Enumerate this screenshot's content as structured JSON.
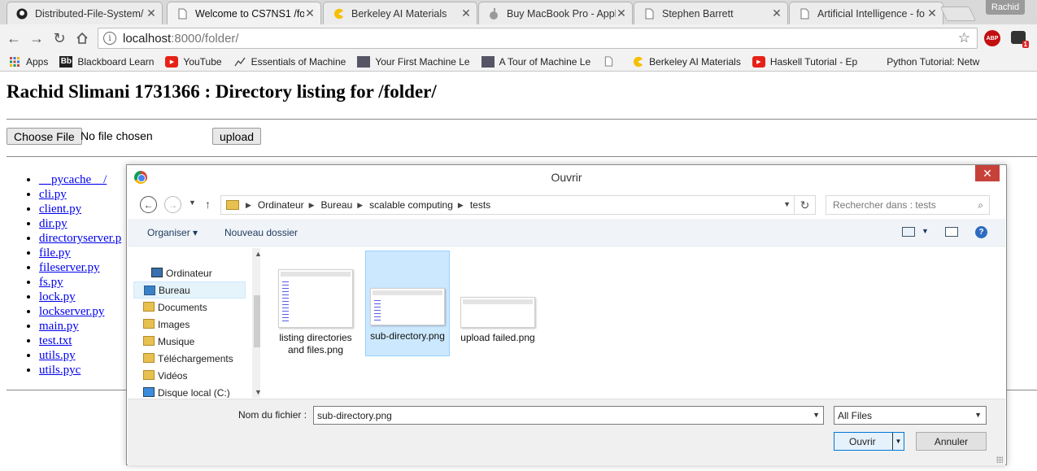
{
  "tabs": [
    {
      "title": "Distributed-File-System/",
      "icon": "github-icon"
    },
    {
      "title": "Welcome to CS7NS1 /fol",
      "icon": "page-icon",
      "active": true
    },
    {
      "title": "Berkeley AI Materials",
      "icon": "pacman-icon"
    },
    {
      "title": "Buy MacBook Pro - Appl",
      "icon": "apple-icon"
    },
    {
      "title": "Stephen Barrett",
      "icon": "page-icon"
    },
    {
      "title": "Artificial Intelligence - fo",
      "icon": "page-icon"
    }
  ],
  "profile_name": "Rachid",
  "address": {
    "host": "localhost",
    "rest": ":8000/folder/"
  },
  "extensions": {
    "abp_label": "ABP",
    "badge_count": "1"
  },
  "bookmarks": [
    {
      "label": "Apps",
      "icon": "apps-grid-icon"
    },
    {
      "label": "Blackboard Learn",
      "icon": "blackboard-icon"
    },
    {
      "label": "YouTube",
      "icon": "youtube-icon"
    },
    {
      "label": "Essentials of Machine",
      "icon": "chart-icon"
    },
    {
      "label": "Your First Machine Le",
      "icon": "person-icon"
    },
    {
      "label": "A Tour of Machine Le",
      "icon": "person-icon"
    },
    {
      "label": "",
      "icon": "page-icon"
    },
    {
      "label": "Berkeley AI Materials",
      "icon": "pacman-icon"
    },
    {
      "label": "Haskell Tutorial - Ep",
      "icon": "youtube-icon"
    },
    {
      "label": "Python Tutorial: Netw",
      "icon": "blank-icon"
    }
  ],
  "page": {
    "heading": "Rachid Slimani 1731366 : Directory listing for /folder/",
    "choose_file_label": "Choose File",
    "no_file_text": "No file chosen",
    "upload_label": "upload",
    "files": [
      "__pycache__/",
      "cli.py",
      "client.py",
      "dir.py",
      "directoryserver.p",
      "file.py",
      "fileserver.py",
      "fs.py",
      "lock.py",
      "lockserver.py",
      "main.py",
      "test.txt",
      "utils.py",
      "utils.pyc"
    ]
  },
  "dialog": {
    "title": "Ouvrir",
    "breadcrumb": [
      "Ordinateur",
      "Bureau",
      "scalable computing",
      "tests"
    ],
    "search_placeholder": "Rechercher dans : tests",
    "organize_label": "Organiser ▾",
    "new_folder_label": "Nouveau dossier",
    "nav_items": [
      {
        "label": "Ordinateur",
        "icon": "computer-icon"
      },
      {
        "label": "Bureau",
        "icon": "desktop-folder-icon",
        "selected": true
      },
      {
        "label": "Documents",
        "icon": "documents-folder-icon"
      },
      {
        "label": "Images",
        "icon": "images-folder-icon"
      },
      {
        "label": "Musique",
        "icon": "music-folder-icon"
      },
      {
        "label": "Téléchargements",
        "icon": "downloads-folder-icon"
      },
      {
        "label": "Vidéos",
        "icon": "videos-folder-icon"
      },
      {
        "label": "Disque local (C:)",
        "icon": "disk-icon"
      }
    ],
    "files": [
      {
        "name": "listing directories and files.png"
      },
      {
        "name": "sub-directory.png",
        "selected": true
      },
      {
        "name": "upload failed.png"
      }
    ],
    "filename_label": "Nom du fichier :",
    "filename_value": "sub-directory.png",
    "filter_value": "All Files",
    "open_label": "Ouvrir",
    "cancel_label": "Annuler"
  }
}
